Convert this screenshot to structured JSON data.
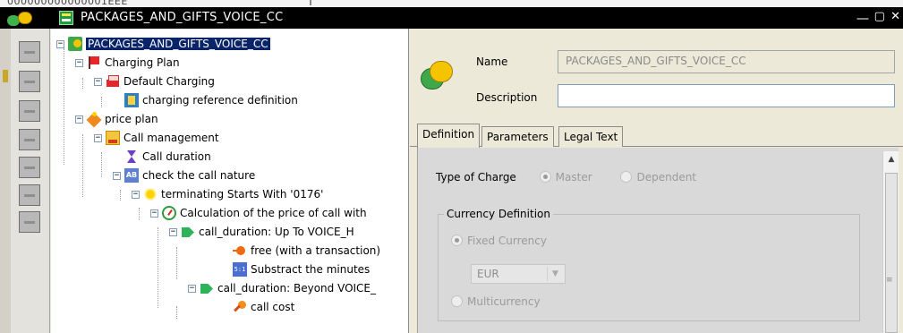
{
  "top_strip": {
    "partial_text": "000000000000001EEE"
  },
  "window": {
    "title": "PACKAGES_AND_GIFTS_VOICE_CC",
    "controls": "⎼ ▢ ✕"
  },
  "toolbar": {
    "buttons": [
      "tool-1",
      "tool-2",
      "tool-3",
      "tool-4",
      "tool-5",
      "tool-6",
      "tool-7"
    ]
  },
  "tree": {
    "nodes": [
      {
        "label": "PACKAGES_AND_GIFTS_VOICE_CC",
        "icon": "package-icon",
        "toggle": "−",
        "selected": true
      },
      {
        "label": "Charging Plan",
        "icon": "flag-icon",
        "toggle": "−"
      },
      {
        "label": "Default Charging",
        "icon": "flag-icon",
        "toggle": "−"
      },
      {
        "label": "charging reference definition",
        "icon": "charging-reference-icon",
        "toggle": ""
      },
      {
        "label": "price plan",
        "icon": "price-plan-icon",
        "toggle": "−"
      },
      {
        "label": "Call management",
        "icon": "call-management-icon",
        "toggle": "−"
      },
      {
        "label": "Call duration",
        "icon": "hourglass-icon",
        "toggle": ""
      },
      {
        "label": "check the call nature",
        "icon": "ab-icon",
        "toggle": "−"
      },
      {
        "label": "terminating Starts With '0176'",
        "icon": "sun-icon",
        "toggle": "−"
      },
      {
        "label": "Calculation of the price of call with",
        "icon": "gauge-icon",
        "toggle": "−"
      },
      {
        "label": "call_duration: Up To VOICE_H",
        "icon": "tab-icon",
        "toggle": "−"
      },
      {
        "label": "free (with a transaction)",
        "icon": "free-icon",
        "toggle": ""
      },
      {
        "label": "Substract the minutes",
        "icon": "subtract-icon",
        "toggle": ""
      },
      {
        "label": "call_duration: Beyond VOICE_",
        "icon": "tab-icon",
        "toggle": "−"
      },
      {
        "label": "call cost",
        "icon": "cost-icon",
        "toggle": ""
      }
    ]
  },
  "form": {
    "name_label": "Name",
    "name_value": "PACKAGES_AND_GIFTS_VOICE_CC",
    "description_label": "Description",
    "description_value": ""
  },
  "tabs": [
    {
      "label": "Definition",
      "active": true
    },
    {
      "label": "Parameters",
      "active": false
    },
    {
      "label": "Legal Text",
      "active": false
    }
  ],
  "definition": {
    "type_of_charge_label": "Type of Charge",
    "type_options": [
      "Master",
      "Dependent"
    ],
    "currency_group_title": "Currency Definition",
    "fixed_currency_label": "Fixed Currency",
    "currency_value": "EUR",
    "multicurrency_label": "Multicurrency"
  }
}
